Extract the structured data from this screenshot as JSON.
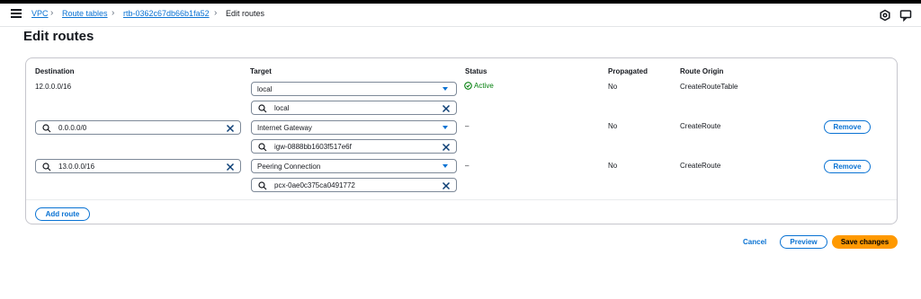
{
  "breadcrumb": {
    "items": [
      "VPC",
      "Route tables",
      "rtb-0362c67db66b1fa52",
      "Edit routes"
    ]
  },
  "page": {
    "title": "Edit routes"
  },
  "table": {
    "headers": {
      "destination": "Destination",
      "target": "Target",
      "status": "Status",
      "propagated": "Propagated",
      "route_origin": "Route Origin"
    },
    "rows": [
      {
        "destination": "12.0.0.0/16",
        "target_type": "local",
        "target_id": "local",
        "status": "Active",
        "propagated": "No",
        "route_origin": "CreateRouteTable"
      },
      {
        "destination": "0.0.0.0/0",
        "target_type": "Internet Gateway",
        "target_id": "igw-0888bb1603f517e6f",
        "status": "–",
        "propagated": "No",
        "route_origin": "CreateRoute",
        "remove_label": "Remove"
      },
      {
        "destination": "13.0.0.0/16",
        "target_type": "Peering Connection",
        "target_id": "pcx-0ae0c375ca0491772",
        "status": "–",
        "propagated": "No",
        "route_origin": "CreateRoute",
        "remove_label": "Remove"
      }
    ]
  },
  "actions": {
    "add_route": "Add route",
    "cancel": "Cancel",
    "preview": "Preview",
    "save": "Save changes"
  },
  "icons": {
    "menu": "menu-icon",
    "settings": "settings-icon",
    "notifications": "notifications-icon",
    "search": "search-icon",
    "clear": "clear-icon",
    "dropdown": "caret-down-icon",
    "status": "check-circle-icon"
  },
  "colors": {
    "link": "#0972d3",
    "primary": "#ff9900",
    "success": "#037f0c"
  }
}
